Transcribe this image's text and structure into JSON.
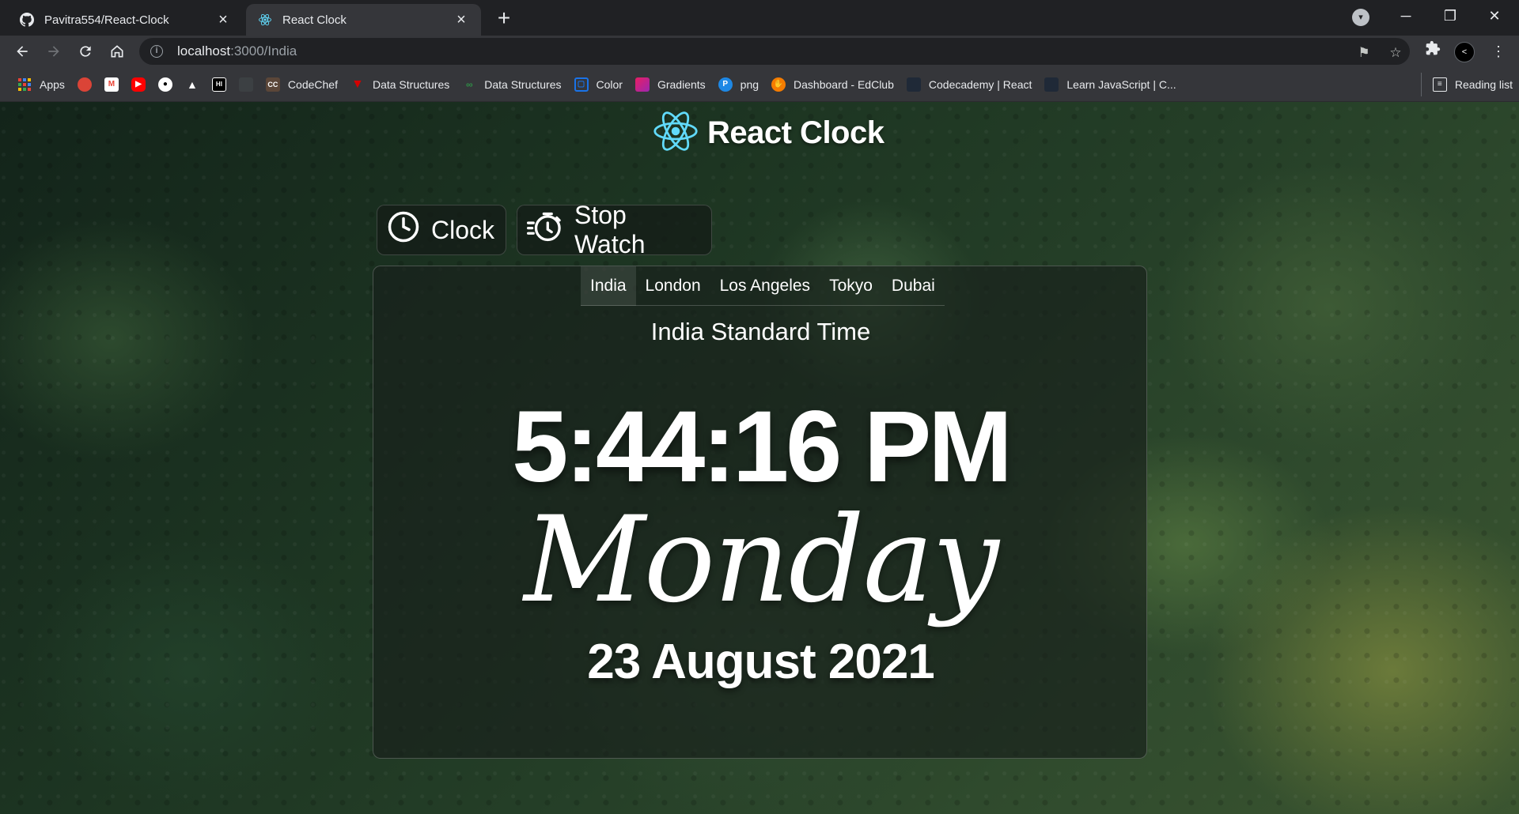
{
  "browser": {
    "tabs": [
      {
        "title": "Pavitra554/React-Clock",
        "icon": "github-icon"
      },
      {
        "title": "React Clock",
        "icon": "react-icon"
      }
    ],
    "url_host": "localhost",
    "url_path": ":3000/India"
  },
  "bookmarks": {
    "items": [
      {
        "label": "Apps",
        "icon": "apps-grid-icon",
        "color": "#4285f4"
      },
      {
        "label": "",
        "icon": "chrome-app-icon",
        "color": "#db4437"
      },
      {
        "label": "",
        "icon": "gmail-icon",
        "color": "#ea4335"
      },
      {
        "label": "",
        "icon": "youtube-icon",
        "color": "#ff0000"
      },
      {
        "label": "",
        "icon": "github-icon",
        "color": "#ffffff"
      },
      {
        "label": "",
        "icon": "drive-icon",
        "color": "#ffffff"
      },
      {
        "label": "",
        "icon": "hackerrank-icon",
        "color": "#000000"
      },
      {
        "label": "",
        "icon": "blank-bookmark-icon",
        "color": "#3c4043"
      },
      {
        "label": "CodeChef",
        "icon": "codechef-icon",
        "color": "#5b4638"
      },
      {
        "label": "Data Structures",
        "icon": "data-structures-red-icon",
        "color": "#d50000"
      },
      {
        "label": "Data Structures",
        "icon": "data-structures-green-icon",
        "color": "#2f8d46"
      },
      {
        "label": "Color",
        "icon": "color-icon",
        "color": "#1a73e8"
      },
      {
        "label": "Gradients",
        "icon": "gradients-icon",
        "color": "#e91e63"
      },
      {
        "label": "png",
        "icon": "png-icon",
        "color": "#1e88e5"
      },
      {
        "label": "Dashboard - EdClub",
        "icon": "edclub-icon",
        "color": "#f57c00"
      },
      {
        "label": "Codecademy | React",
        "icon": "codecademy-icon",
        "color": "#1f2937"
      },
      {
        "label": "Learn JavaScript | C...",
        "icon": "codecademy-icon",
        "color": "#1f2937"
      }
    ],
    "reading_list": "Reading list"
  },
  "app": {
    "title": "React Clock",
    "modes": [
      {
        "label": "Clock",
        "icon": "clock-icon"
      },
      {
        "label": "Stop Watch",
        "icon": "stopwatch-icon"
      }
    ],
    "cities": [
      "India",
      "London",
      "Los Angeles",
      "Tokyo",
      "Dubai"
    ],
    "active_city": "India",
    "timezone_name": "India Standard Time",
    "time": "5:44:16 PM",
    "day": "Monday",
    "date": "23 August 2021"
  },
  "colors": {
    "react_cyan": "#61dafb",
    "chrome_dark": "#202124",
    "chrome_toolbar": "#35363a"
  }
}
